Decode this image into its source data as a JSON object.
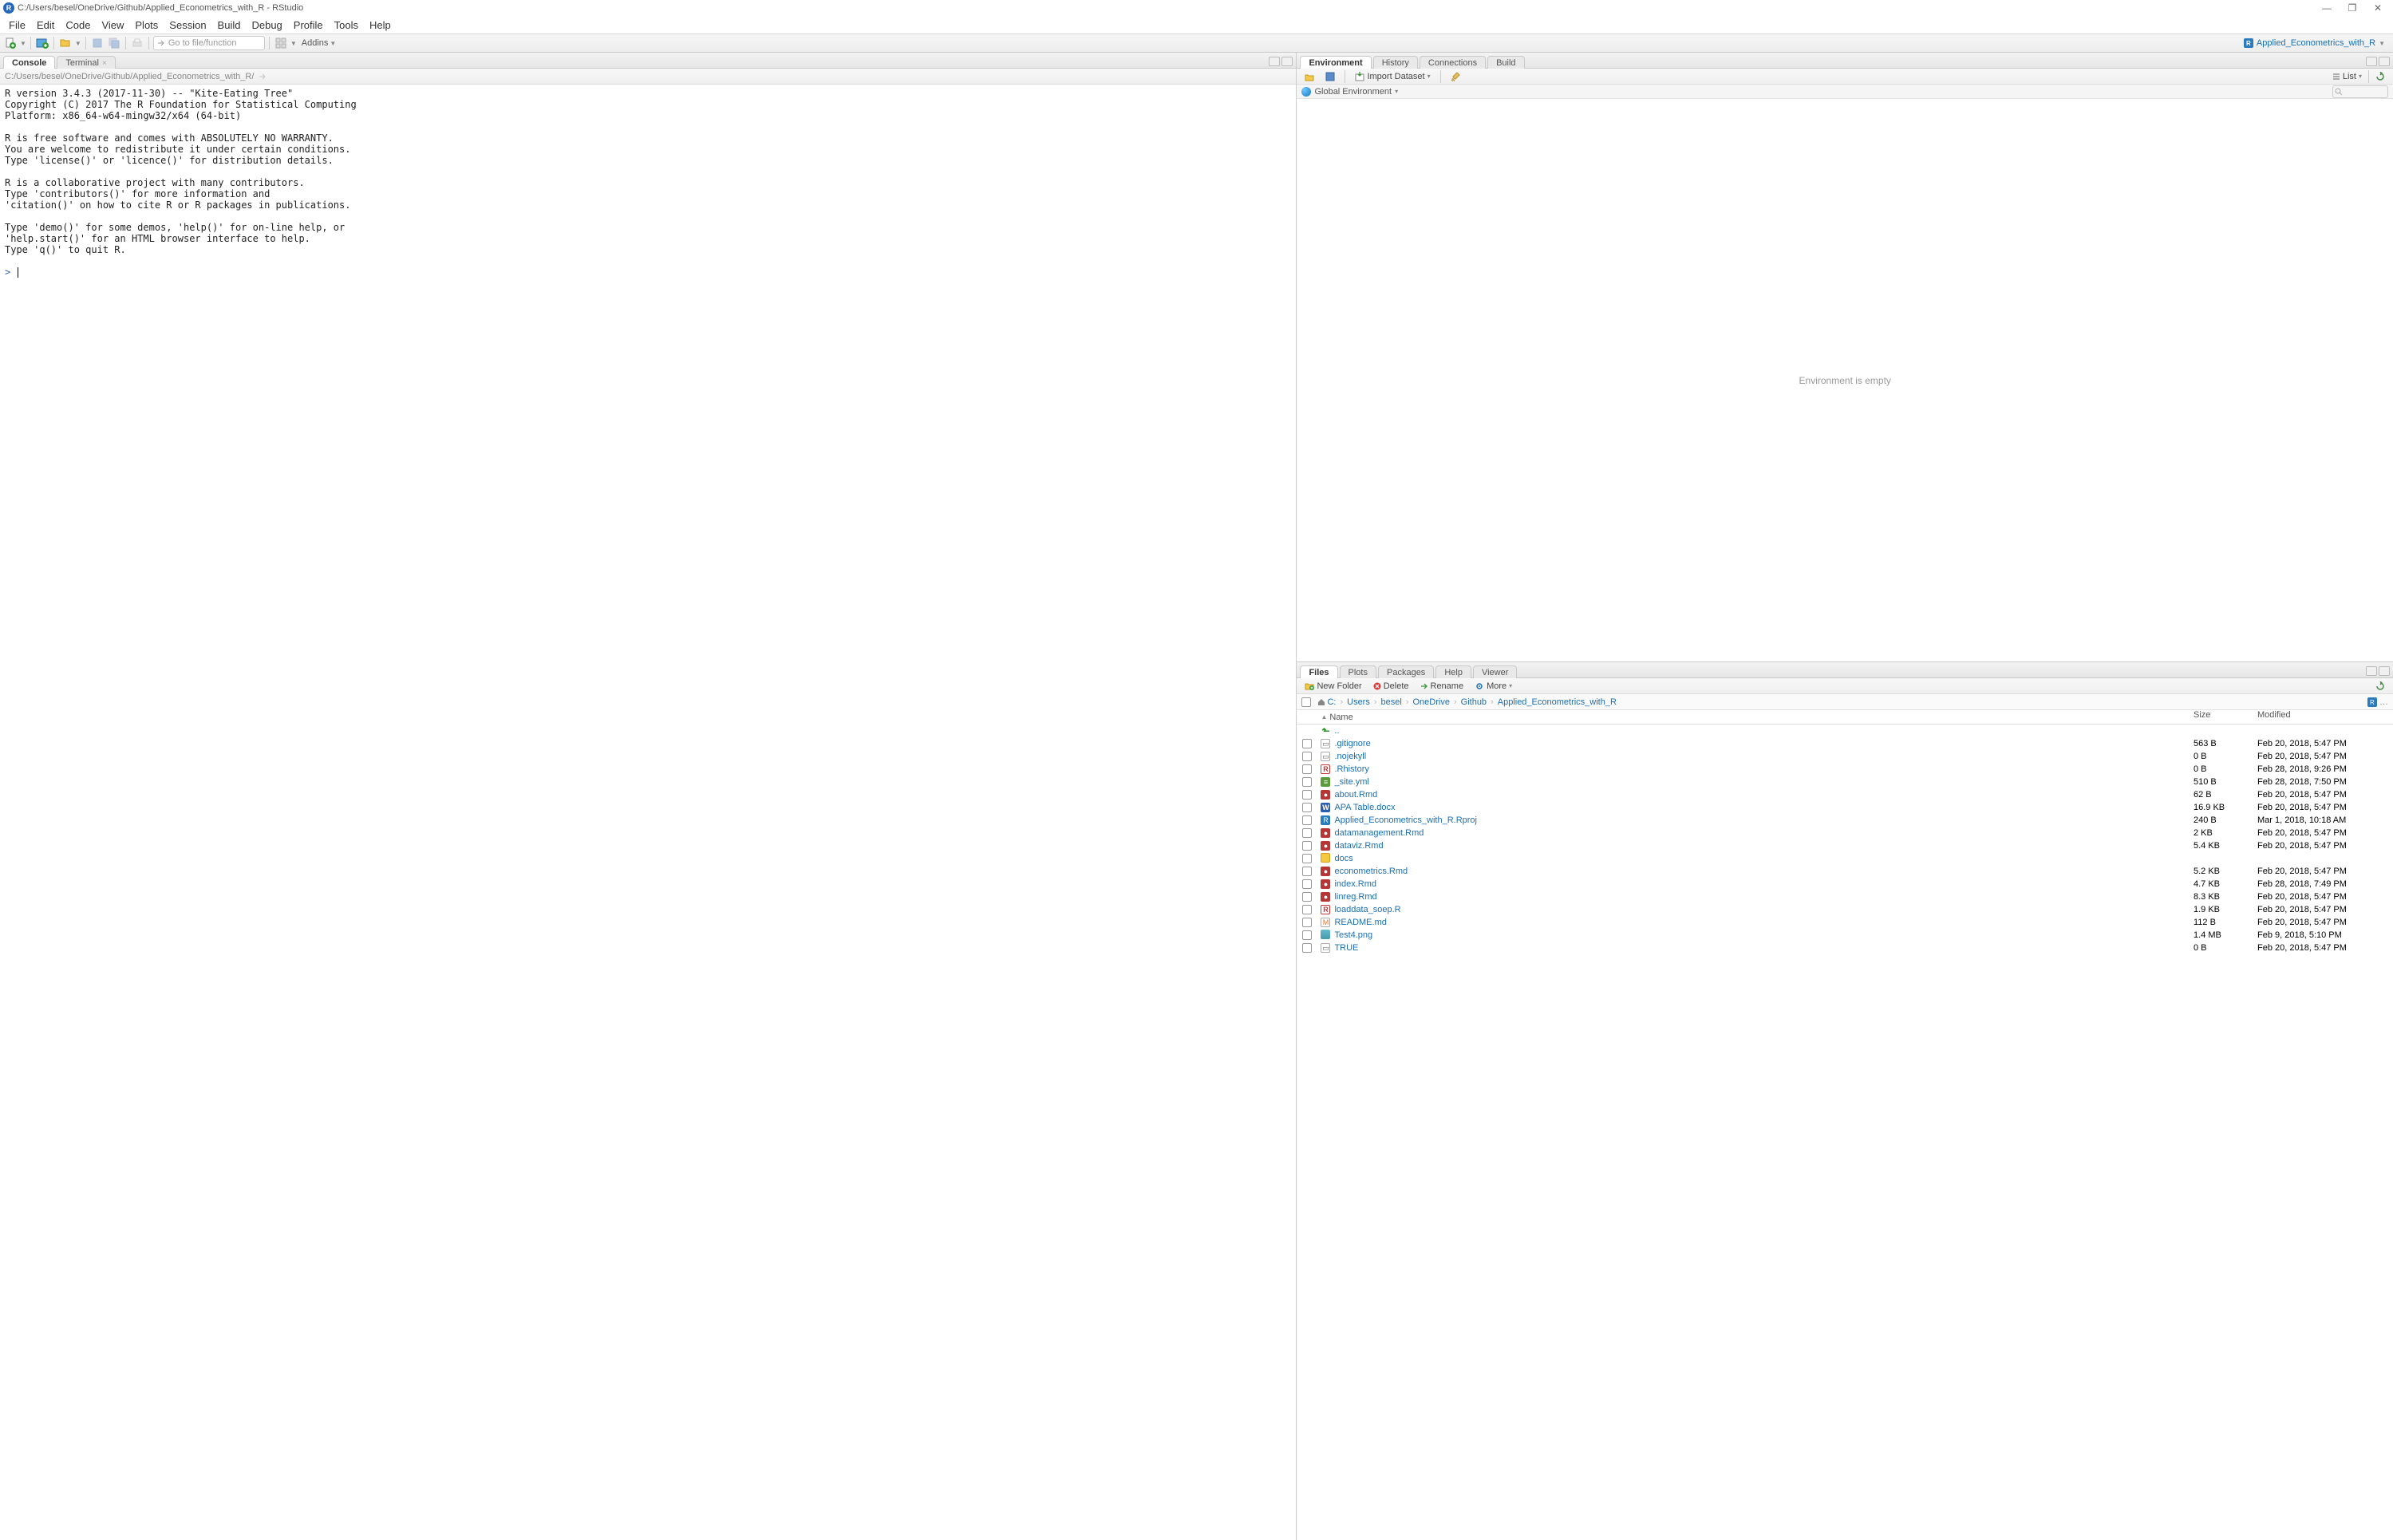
{
  "window": {
    "title": "C:/Users/besel/OneDrive/Github/Applied_Econometrics_with_R - RStudio"
  },
  "menu": [
    "File",
    "Edit",
    "Code",
    "View",
    "Plots",
    "Session",
    "Build",
    "Debug",
    "Profile",
    "Tools",
    "Help"
  ],
  "toolbar": {
    "goto_placeholder": "Go to file/function",
    "addins": "Addins",
    "project": "Applied_Econometrics_with_R"
  },
  "left_tabs": {
    "console": "Console",
    "terminal": "Terminal"
  },
  "console": {
    "path": "C:/Users/besel/OneDrive/Github/Applied_Econometrics_with_R/",
    "body": "R version 3.4.3 (2017-11-30) -- \"Kite-Eating Tree\"\nCopyright (C) 2017 The R Foundation for Statistical Computing\nPlatform: x86_64-w64-mingw32/x64 (64-bit)\n\nR is free software and comes with ABSOLUTELY NO WARRANTY.\nYou are welcome to redistribute it under certain conditions.\nType 'license()' or 'licence()' for distribution details.\n\nR is a collaborative project with many contributors.\nType 'contributors()' for more information and\n'citation()' on how to cite R or R packages in publications.\n\nType 'demo()' for some demos, 'help()' for on-line help, or\n'help.start()' for an HTML browser interface to help.\nType 'q()' to quit R.\n",
    "prompt": ">"
  },
  "env_tabs": {
    "env": "Environment",
    "history": "History",
    "conn": "Connections",
    "build": "Build"
  },
  "env_toolbar": {
    "import": "Import Dataset",
    "global": "Global Environment",
    "list": "List",
    "empty": "Environment is empty"
  },
  "files_tabs": {
    "files": "Files",
    "plots": "Plots",
    "packages": "Packages",
    "help": "Help",
    "viewer": "Viewer"
  },
  "files_toolbar": {
    "new_folder": "New Folder",
    "delete": "Delete",
    "rename": "Rename",
    "more": "More"
  },
  "breadcrumb": [
    "C:",
    "Users",
    "besel",
    "OneDrive",
    "Github",
    "Applied_Econometrics_with_R"
  ],
  "files_header": {
    "name": "Name",
    "size": "Size",
    "modified": "Modified"
  },
  "files": [
    {
      "icon": "up",
      "name": "..",
      "size": "",
      "mod": ""
    },
    {
      "icon": "txt",
      "name": ".gitignore",
      "size": "563 B",
      "mod": "Feb 20, 2018, 5:47 PM"
    },
    {
      "icon": "txt",
      "name": ".nojekyll",
      "size": "0 B",
      "mod": "Feb 20, 2018, 5:47 PM"
    },
    {
      "icon": "r",
      "name": ".Rhistory",
      "size": "0 B",
      "mod": "Feb 28, 2018, 9:26 PM"
    },
    {
      "icon": "yml",
      "name": "_site.yml",
      "size": "510 B",
      "mod": "Feb 28, 2018, 7:50 PM"
    },
    {
      "icon": "rmd",
      "name": "about.Rmd",
      "size": "62 B",
      "mod": "Feb 20, 2018, 5:47 PM"
    },
    {
      "icon": "w",
      "name": "APA Table.docx",
      "size": "16.9 KB",
      "mod": "Feb 20, 2018, 5:47 PM"
    },
    {
      "icon": "rp",
      "name": "Applied_Econometrics_with_R.Rproj",
      "size": "240 B",
      "mod": "Mar 1, 2018, 10:18 AM"
    },
    {
      "icon": "rmd",
      "name": "datamanagement.Rmd",
      "size": "2 KB",
      "mod": "Feb 20, 2018, 5:47 PM"
    },
    {
      "icon": "rmd",
      "name": "dataviz.Rmd",
      "size": "5.4 KB",
      "mod": "Feb 20, 2018, 5:47 PM"
    },
    {
      "icon": "fold",
      "name": "docs",
      "size": "",
      "mod": ""
    },
    {
      "icon": "rmd",
      "name": "econometrics.Rmd",
      "size": "5.2 KB",
      "mod": "Feb 20, 2018, 5:47 PM"
    },
    {
      "icon": "rmd",
      "name": "index.Rmd",
      "size": "4.7 KB",
      "mod": "Feb 28, 2018, 7:49 PM"
    },
    {
      "icon": "rmd",
      "name": "linreg.Rmd",
      "size": "8.3 KB",
      "mod": "Feb 20, 2018, 5:47 PM"
    },
    {
      "icon": "r",
      "name": "loaddata_soep.R",
      "size": "1.9 KB",
      "mod": "Feb 20, 2018, 5:47 PM"
    },
    {
      "icon": "md",
      "name": "README.md",
      "size": "112 B",
      "mod": "Feb 20, 2018, 5:47 PM"
    },
    {
      "icon": "img",
      "name": "Test4.png",
      "size": "1.4 MB",
      "mod": "Feb 9, 2018, 5:10 PM"
    },
    {
      "icon": "txt",
      "name": "TRUE",
      "size": "0 B",
      "mod": "Feb 20, 2018, 5:47 PM"
    }
  ]
}
